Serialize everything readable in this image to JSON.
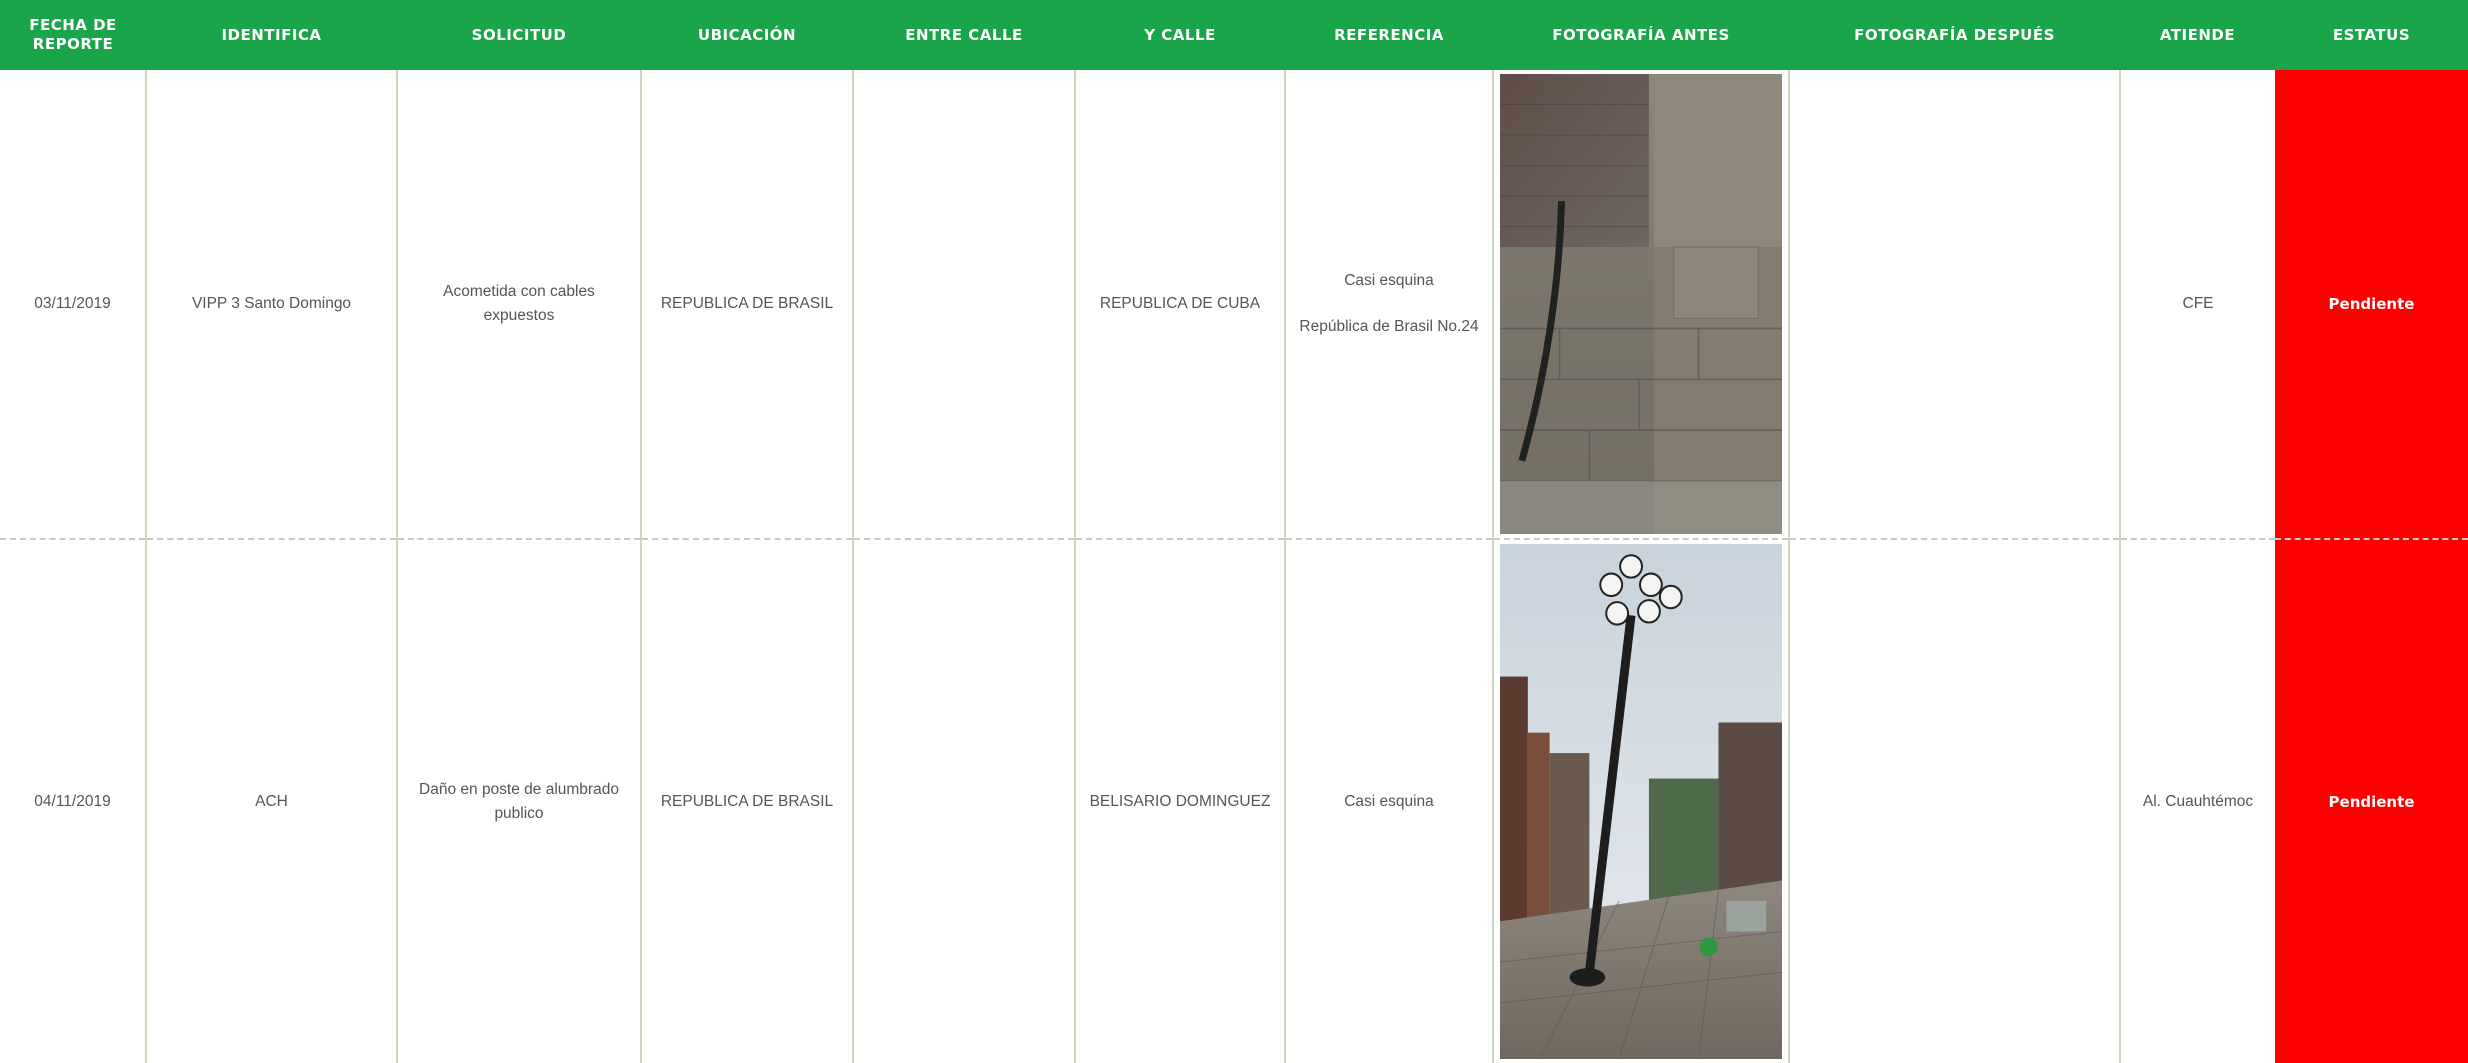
{
  "headers": {
    "fecha": "FECHA DE REPORTE",
    "identifica": "IDENTIFICA",
    "solicitud": "SOLICITUD",
    "ubicacion": "UBICACIÓN",
    "entre_calle": "ENTRE CALLE",
    "y_calle": "Y CALLE",
    "referencia": "REFERENCIA",
    "foto_antes": "FOTOGRAFÍA ANTES",
    "foto_despues": "FOTOGRAFÍA DESPUÉS",
    "atiende": "ATIENDE",
    "estatus": "ESTATUS"
  },
  "rows": [
    {
      "fecha": "03/11/2019",
      "identifica": "VIPP 3 Santo Domingo",
      "solicitud": "Acometida con cables expuestos",
      "ubicacion": "REPUBLICA DE BRASIL",
      "entre_calle": "",
      "y_calle": "REPUBLICA DE CUBA",
      "referencia_1": "Casi esquina",
      "referencia_2": "República de Brasil No.24",
      "foto_antes_icon": "stone-wall-cable-photo",
      "foto_despues": "",
      "atiende": "CFE",
      "estatus": "Pendiente"
    },
    {
      "fecha": "04/11/2019",
      "identifica": "ACH",
      "solicitud": "Daño en poste de alumbrado publico",
      "ubicacion": "REPUBLICA DE BRASIL",
      "entre_calle": "",
      "y_calle": "BELISARIO DOMINGUEZ",
      "referencia_1": "Casi esquina",
      "referencia_2": "",
      "foto_antes_icon": "leaning-lamppost-photo",
      "foto_despues": "",
      "atiende": "Al. Cuauhtémoc",
      "estatus": "Pendiente"
    }
  ],
  "colors": {
    "header_green": "#1aa54b",
    "status_red": "#ff0000"
  }
}
